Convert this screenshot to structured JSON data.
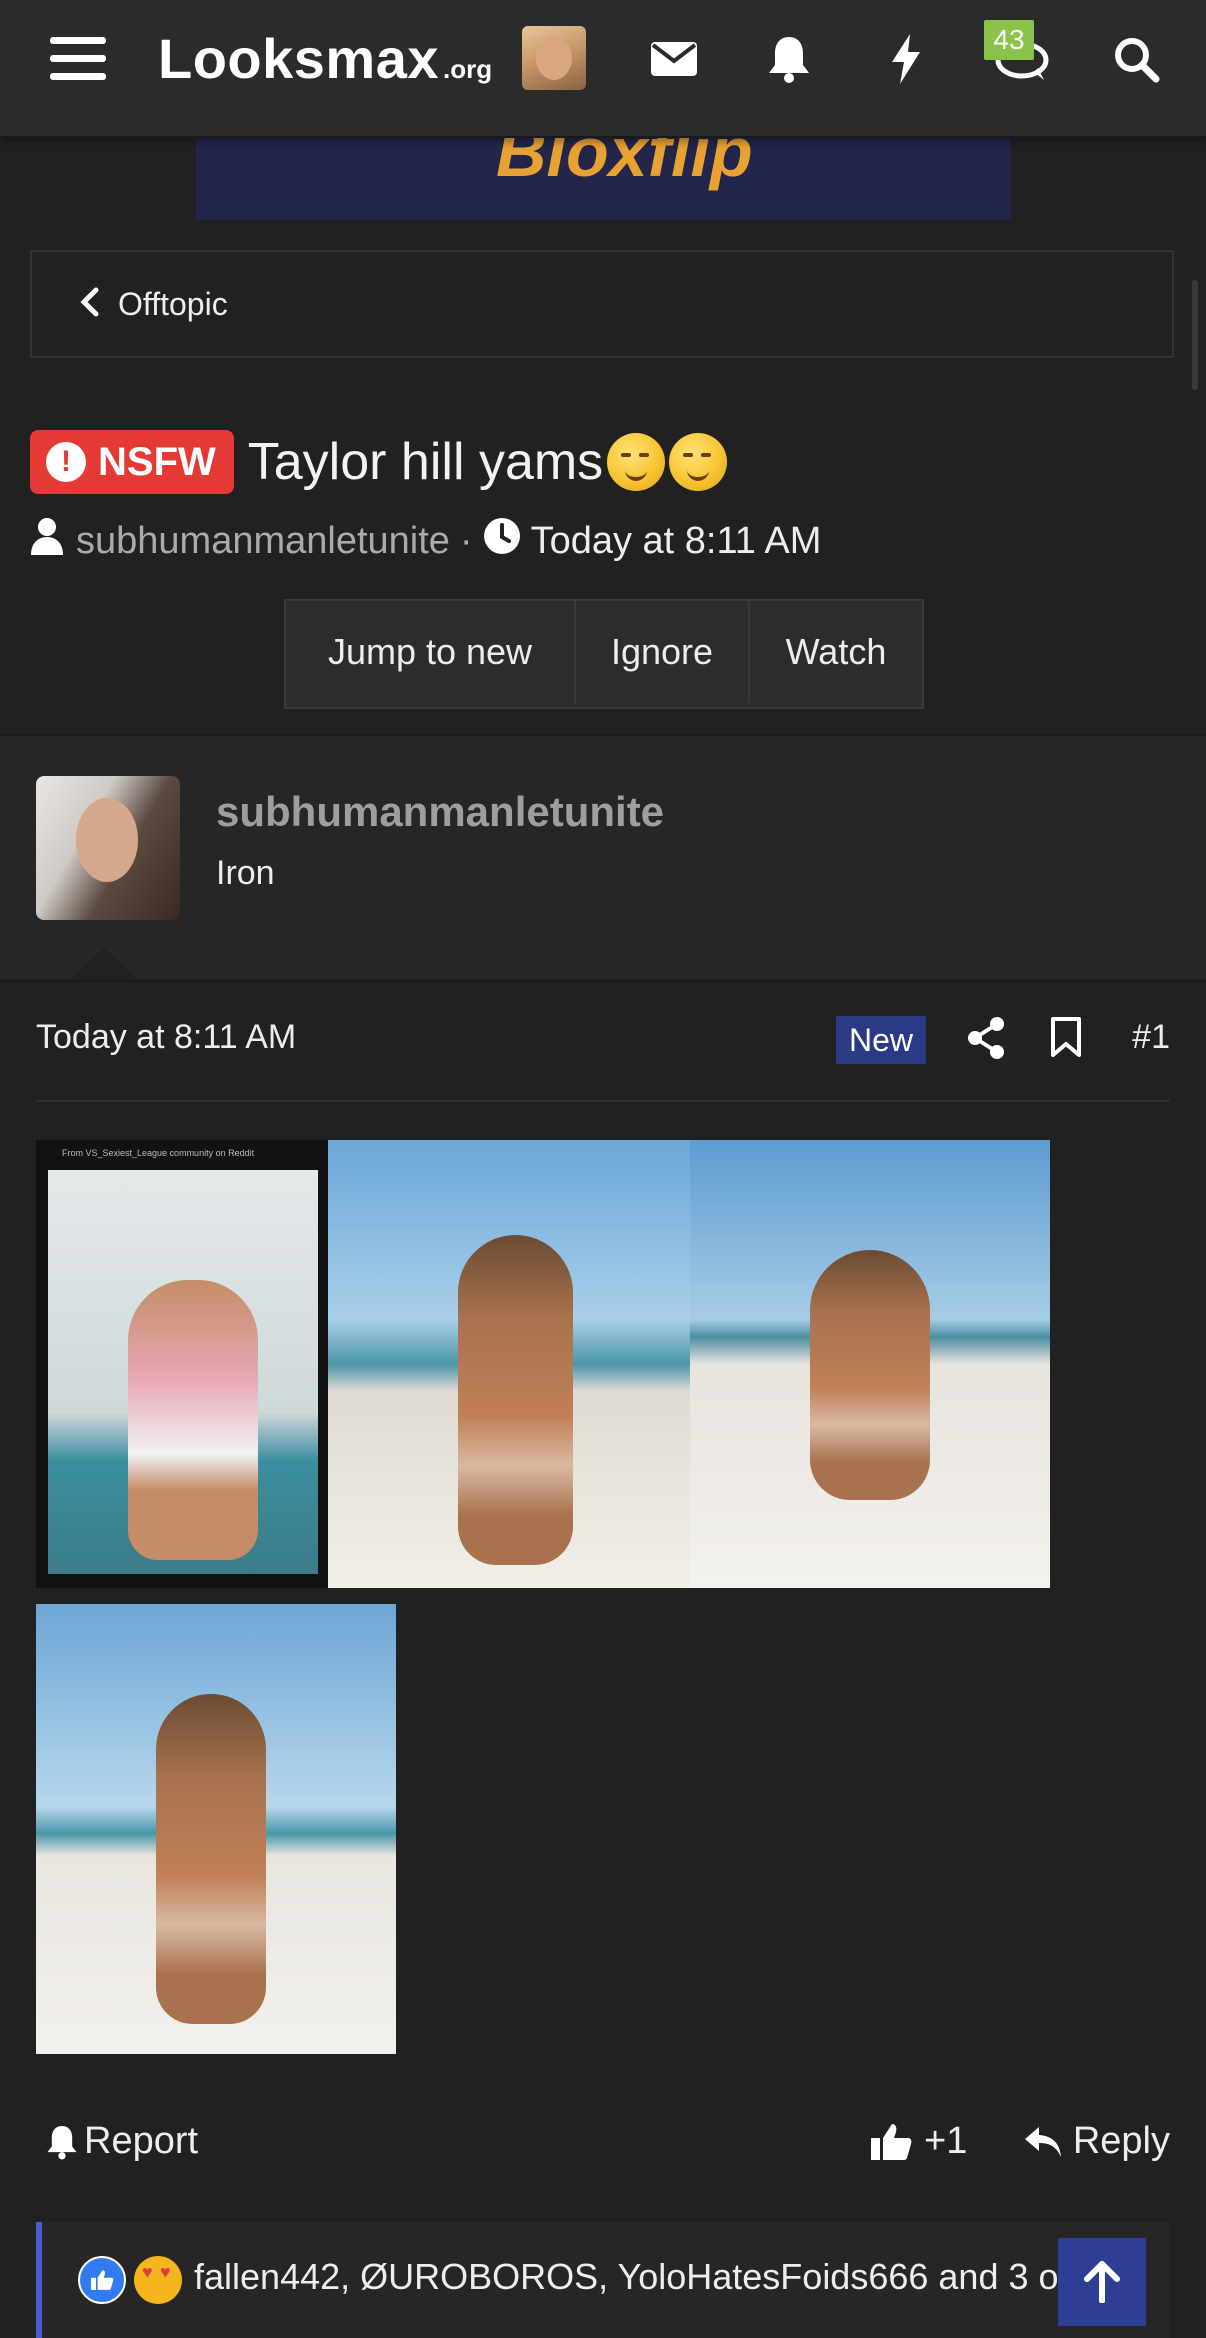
{
  "site": {
    "logo_main": "Looksmax",
    "logo_sub": ".org",
    "conversations_badge": "43"
  },
  "ad": {
    "text": "Bloxflip"
  },
  "breadcrumb": {
    "label": "Offtopic"
  },
  "thread": {
    "prefix": "NSFW",
    "title": "Taylor hill yams",
    "author": "subhumanmanletunite",
    "separator": "·",
    "time": "Today at 8:11 AM",
    "buttons": [
      "Jump to new",
      "Ignore",
      "Watch"
    ]
  },
  "post": {
    "username": "subhumanmanletunite",
    "rank": "Iron",
    "time": "Today at 8:11 AM",
    "new_label": "New",
    "number": "#1",
    "image_source": "From VS_Sexiest_League community on Reddit"
  },
  "actions": {
    "report": "Report",
    "like": "+1",
    "reply": "Reply"
  },
  "reactions": {
    "text": "fallen442, ØUROBOROS, YoloHatesFoids666 and 3 others"
  },
  "colors": {
    "accent": "#2a3a86",
    "nsfw": "#e53935",
    "badge": "#8bc34a",
    "reaction_bar": "#4e5bd0"
  }
}
